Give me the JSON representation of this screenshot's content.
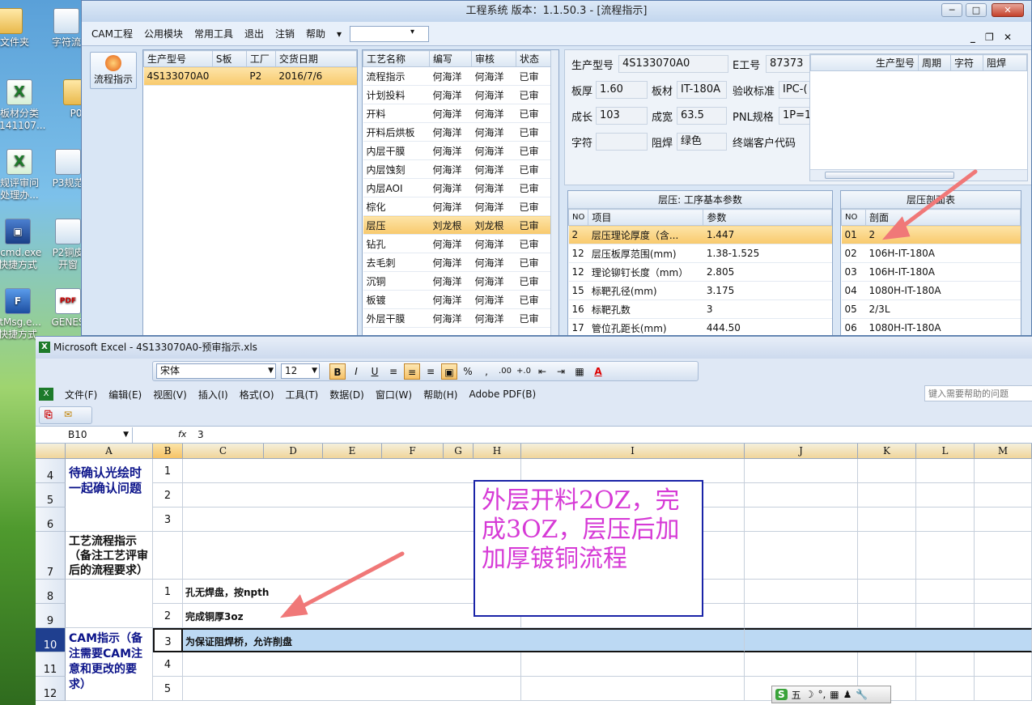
{
  "desktop": {
    "icons": [
      "建文件夹",
      "字符流",
      "板材分类",
      "0141107...",
      "P0",
      "规评审问",
      "处理办...",
      "P3规范",
      "ncmd.exe",
      "快捷方式",
      "P2铜皮",
      "开窗",
      "stMsg.e...",
      "快捷方式",
      "GENES",
      "文件..."
    ]
  },
  "cam": {
    "title": "工程系统   版本：1.1.50.3 - [流程指示]",
    "win_min": "─",
    "win_max": "□",
    "win_close": "✕",
    "mdi_ctrl": "_ ❐ ✕",
    "menu": [
      "CAM工程",
      "公用模块",
      "常用工具",
      "退出",
      "注销",
      "帮助"
    ],
    "menu_arrow": "▾",
    "combo_arrow": "▾",
    "nav_label": "流程指示",
    "orders": {
      "headers": [
        "生产型号",
        "S板",
        "工厂",
        "交货日期"
      ],
      "rows": [
        [
          "4S133070A0",
          "",
          "P2",
          "2016/7/6"
        ]
      ]
    },
    "process": {
      "headers": [
        "工艺名称",
        "编写",
        "审核",
        "状态"
      ],
      "rows": [
        [
          "流程指示",
          "何海洋",
          "何海洋",
          "已审"
        ],
        [
          "计划投料",
          "何海洋",
          "何海洋",
          "已审"
        ],
        [
          "开料",
          "何海洋",
          "何海洋",
          "已审"
        ],
        [
          "开料后烘板",
          "何海洋",
          "何海洋",
          "已审"
        ],
        [
          "内层干膜",
          "何海洋",
          "何海洋",
          "已审"
        ],
        [
          "内层蚀刻",
          "何海洋",
          "何海洋",
          "已审"
        ],
        [
          "内层AOI",
          "何海洋",
          "何海洋",
          "已审"
        ],
        [
          "棕化",
          "何海洋",
          "何海洋",
          "已审"
        ],
        [
          "层压",
          "刘龙根",
          "刘龙根",
          "已审"
        ],
        [
          "钻孔",
          "何海洋",
          "何海洋",
          "已审"
        ],
        [
          "去毛刺",
          "何海洋",
          "何海洋",
          "已审"
        ],
        [
          "沉铜",
          "何海洋",
          "何海洋",
          "已审"
        ],
        [
          "板镀",
          "何海洋",
          "何海洋",
          "已审"
        ],
        [
          "外层干膜",
          "何海洋",
          "何海洋",
          "已审"
        ]
      ]
    },
    "info": {
      "prod_label": "生产型号",
      "prod_value": "4S133070A0",
      "e_label": "E工号",
      "e_value": "87373",
      "thick_label": "板厚",
      "thick_value": "1.60",
      "mat_label": "板材",
      "mat_value": "IT-180A",
      "std_label": "验收标准",
      "std_value": "IPC-(",
      "len_label": "成长",
      "len_value": "103",
      "wid_label": "成宽",
      "wid_value": "63.5",
      "pnl_label": "PNL规格",
      "pnl_value": "1P=1",
      "char_label": "字符",
      "char_value": "",
      "mask_label": "阻焊",
      "mask_value": "绿色",
      "cust_label": "终端客户代码",
      "side_headers": [
        "生产型号",
        "周期",
        "字符",
        "阻焊"
      ]
    },
    "params": {
      "title": "层压: 工序基本参数",
      "headers": [
        "NO",
        "项目",
        "参数"
      ],
      "rows": [
        [
          "2",
          "层压理论厚度（含...",
          "1.447"
        ],
        [
          "12",
          "层压板厚范围(mm)",
          "1.38-1.525"
        ],
        [
          "12",
          "理论铆钉长度（mm）",
          "2.805"
        ],
        [
          "15",
          "标靶孔径(mm)",
          "3.175"
        ],
        [
          "16",
          "标靶孔数",
          "3"
        ],
        [
          "17",
          "管位孔距长(mm)",
          "444.50"
        ]
      ]
    },
    "stack": {
      "title": "层压剖面表",
      "headers": [
        "NO",
        "剖面"
      ],
      "rows": [
        [
          "01",
          "2"
        ],
        [
          "02",
          "106H-IT-180A"
        ],
        [
          "03",
          "106H-IT-180A"
        ],
        [
          "04",
          "1080H-IT-180A"
        ],
        [
          "05",
          "2/3L"
        ],
        [
          "06",
          "1080H-IT-180A"
        ]
      ]
    }
  },
  "excel": {
    "title": "Microsoft Excel - 4S133070A0-预审指示.xls",
    "font_name": "宋体",
    "font_size": "12",
    "toolbar": [
      "B",
      "I",
      "U",
      "≡",
      "≡",
      "≡",
      "▣",
      "%",
      ",",
      ".00",
      "+.0",
      "⇤",
      "⇥",
      "▦",
      "A"
    ],
    "menu": [
      "文件(F)",
      "编辑(E)",
      "视图(V)",
      "插入(I)",
      "格式(O)",
      "工具(T)",
      "数据(D)",
      "窗口(W)",
      "帮助(H)",
      "Adobe PDF(B)"
    ],
    "help_placeholder": "键入需要帮助的问题",
    "namebox": "B10",
    "fx": "fx",
    "formula": "3",
    "columns": [
      "A",
      "B",
      "C",
      "D",
      "E",
      "F",
      "G",
      "H",
      "I",
      "J",
      "K",
      "L",
      "M"
    ],
    "rows": [
      "4",
      "5",
      "6",
      "7",
      "8",
      "9",
      "10",
      "11",
      "12"
    ],
    "a_confirm": "待确认光绘时一起确认问题",
    "a_process": "工艺流程指示（备注工艺评审后的流程要求）",
    "a_cam": "CAM指示（备注需要CAM注意和更改的要求）",
    "b_vals": [
      "1",
      "2",
      "3",
      "1",
      "2",
      "3",
      "4",
      "5"
    ],
    "c_vals": [
      "孔无焊盘，按npth",
      "完成铜厚3oz",
      "为保证阻焊桥，允许削盘"
    ],
    "note": "外层开料2OZ，完成3OZ，层压后加加厚镀铜流程"
  },
  "tray": [
    "S",
    "五",
    "☽",
    "°,",
    "▦",
    "♟",
    "🔧"
  ],
  "colors": {
    "accent": "#f3c56b",
    "note_text": "#d63ad6",
    "arrow": "#f07878"
  }
}
